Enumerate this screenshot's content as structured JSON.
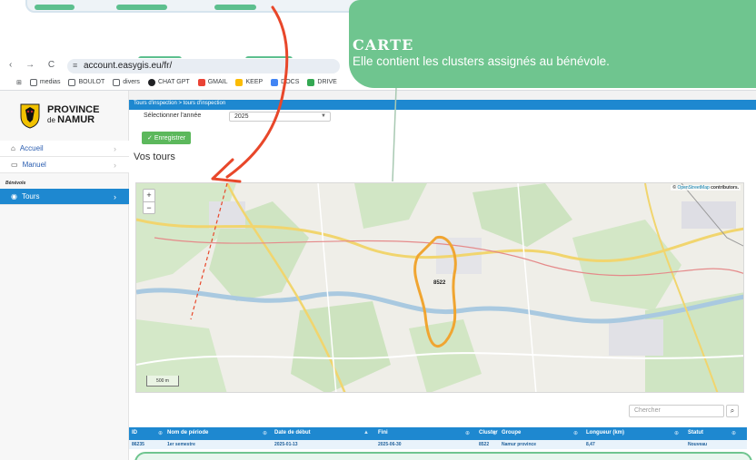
{
  "browser": {
    "nav_glyphs": "‹ → C",
    "url": "account.easygis.eu/fr/",
    "bookmarks": [
      {
        "label": "medias",
        "color": "#5f6368"
      },
      {
        "label": "BOULOT",
        "color": "#5f6368"
      },
      {
        "label": "divers",
        "color": "#5f6368"
      },
      {
        "label": "CHAT GPT",
        "color": "#202124"
      },
      {
        "label": "GMAIL",
        "color": "#ea4335"
      },
      {
        "label": "KEEP",
        "color": "#fbbc04"
      },
      {
        "label": "DOCS",
        "color": "#4285f4"
      },
      {
        "label": "DRIVE",
        "color": "#34a853"
      }
    ]
  },
  "sidebar": {
    "logo": {
      "line1": "PROVINCE",
      "line2_prefix": "de",
      "line2": "NAMUR"
    },
    "items": [
      {
        "label": "Accueil",
        "icon": "home-icon"
      },
      {
        "label": "Manuel",
        "icon": "book-icon"
      }
    ],
    "section": "Bénévole",
    "active_item": {
      "label": "Tours",
      "icon": "eye-icon"
    }
  },
  "header": {
    "breadcrumb": "Tours d'inspection > tours d'inspection"
  },
  "form": {
    "year_label": "Sélectionner l'année",
    "year_value": "2025",
    "save_label": "Enregistrer"
  },
  "main": {
    "section_title": "Vos tours"
  },
  "map": {
    "zoom_in": "+",
    "zoom_out": "−",
    "attribution_prefix": "©",
    "attribution_link": "OpenStreetMap",
    "attribution_suffix": "contributors.",
    "cluster_label": "8522",
    "scale": "500 m"
  },
  "table": {
    "search_placeholder": "Chercher",
    "columns": [
      "ID",
      "Nom de période",
      "Date de début",
      "Fini",
      "Cluster",
      "Groupe",
      "Longueur (km)",
      "Statut"
    ],
    "rows": [
      {
        "id": "86235",
        "nom": "1er semestre",
        "debut": "2025-01-13",
        "fini": "2025-06-30",
        "cluster": "8522",
        "groupe": "Namur province",
        "longueur": "8,47",
        "statut": "Nouveau"
      }
    ]
  },
  "callout": {
    "title": "CARTE",
    "text": "Elle contient les clusters assignés au bénévole."
  },
  "colors": {
    "accent": "#1e88d0",
    "callout": "#6fc58f",
    "save": "#5cb85c",
    "arrow": "#e8472a"
  }
}
